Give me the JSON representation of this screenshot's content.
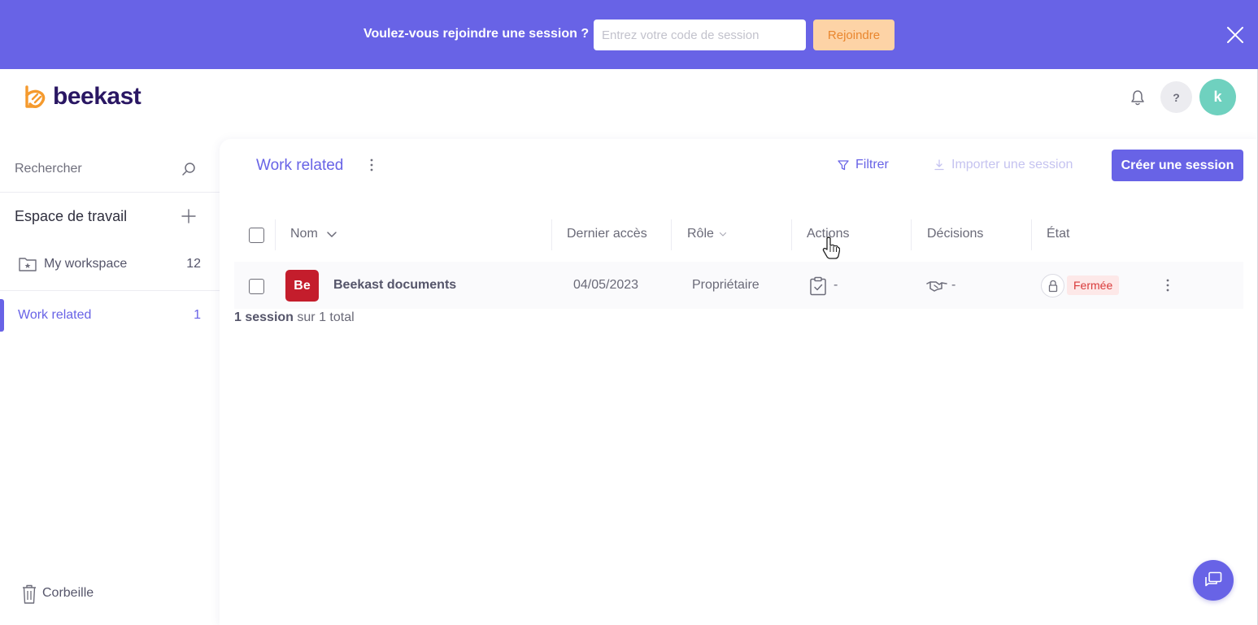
{
  "banner": {
    "prompt": "Voulez-vous rejoindre une session ?",
    "input_placeholder": "Entrez votre code de session",
    "input_value": "",
    "join_label": "Rejoindre"
  },
  "header": {
    "logo_text": "beekast",
    "help_label": "?",
    "avatar_initial": "k"
  },
  "sidebar": {
    "search_label": "Rechercher",
    "workspace_title": "Espace de travail",
    "items": [
      {
        "label": "My workspace",
        "count": "12",
        "icon": "folder-star-icon",
        "active": false
      },
      {
        "label": "Work related",
        "count": "1",
        "icon": "",
        "active": true
      }
    ],
    "trash_label": "Corbeille"
  },
  "main": {
    "title": "Work related",
    "filter_label": "Filtrer",
    "import_label": "Importer une session",
    "create_label": "Créer une session",
    "columns": [
      "Nom",
      "Dernier accès",
      "Rôle",
      "Actions",
      "Décisions",
      "État"
    ],
    "rows": [
      {
        "badge": "Be",
        "name": "Beekast documents",
        "last_access": "04/05/2023",
        "role": "Propriétaire",
        "actions": "-",
        "decisions": "-",
        "state": "Fermée"
      }
    ],
    "summary_count": "1 session",
    "summary_rest": "sur 1 total"
  },
  "colors": {
    "accent": "#6863e6",
    "join_button": "#fdd3a6",
    "badge_red": "#c41d2c",
    "avatar": "#6fd1bf",
    "state_closed": "#d93a3a"
  }
}
